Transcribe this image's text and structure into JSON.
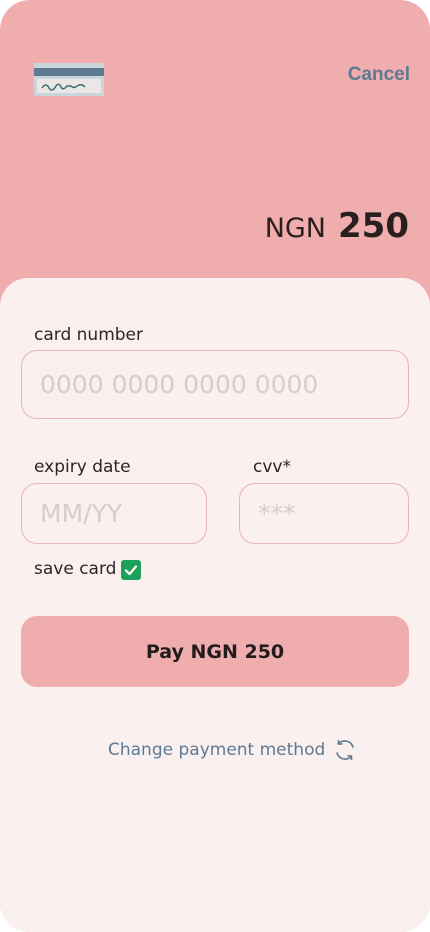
{
  "header": {
    "cancel_label": "Cancel",
    "currency": "NGN",
    "amount": "250",
    "card_icon": "credit-card-icon"
  },
  "form": {
    "card_number_label": "card number",
    "card_number_placeholder": "0000 0000 0000 0000",
    "expiry_label": "expiry date",
    "expiry_placeholder": "MM/YY",
    "cvv_label": "cvv*",
    "cvv_placeholder": "***",
    "save_card_label": "save card",
    "save_card_checked": true
  },
  "actions": {
    "pay_label": "Pay NGN 250",
    "change_method_label": "Change payment method",
    "change_method_icon": "refresh-icon"
  },
  "colors": {
    "accent": "#EFADAD",
    "sheet": "#F9F0EF",
    "link": "#5E7A93",
    "checkbox": "#1FA05A"
  }
}
